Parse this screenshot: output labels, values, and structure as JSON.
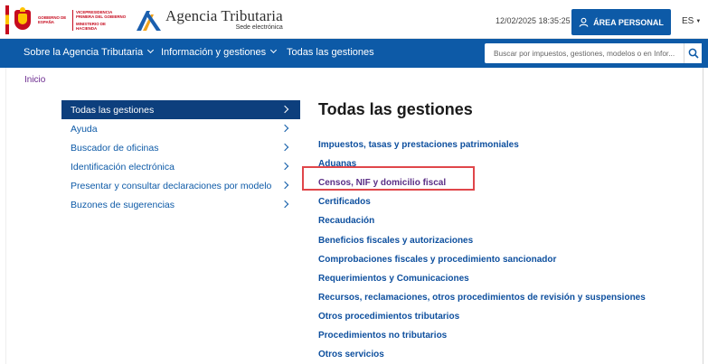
{
  "header": {
    "gov_text_1": "Vicepresidencia Primera del Gobierno",
    "gov_text_2": "Gobierno de España",
    "gov_text_3": "Ministerio de Hacienda",
    "site_title": "Agencia Tributaria",
    "site_subtitle": "Sede electrónica",
    "datetime": "12/02/2025 18:35:25",
    "area_personal_label": "ÁREA PERSONAL",
    "language": "ES",
    "brand_color": "#0d5aa7"
  },
  "nav": {
    "items": [
      {
        "label": "Sobre la Agencia Tributaria"
      },
      {
        "label": "Información y gestiones"
      },
      {
        "label": "Todas las gestiones"
      }
    ],
    "search_placeholder": "Buscar por impuestos, gestiones, modelos o en Infor..."
  },
  "breadcrumb": {
    "label": "Inicio"
  },
  "sidebar": {
    "items": [
      {
        "label": "Todas las gestiones",
        "active": true
      },
      {
        "label": "Ayuda"
      },
      {
        "label": "Buscador de oficinas"
      },
      {
        "label": "Identificación electrónica"
      },
      {
        "label": "Presentar y consultar declaraciones por modelo"
      },
      {
        "label": "Buzones de sugerencias"
      }
    ]
  },
  "main": {
    "title": "Todas las gestiones",
    "gestiones": [
      {
        "label": "Impuestos, tasas y prestaciones patrimoniales"
      },
      {
        "label": "Aduanas"
      },
      {
        "label": "Censos, NIF y domicilio fiscal",
        "highlighted": true
      },
      {
        "label": "Certificados"
      },
      {
        "label": "Recaudación"
      },
      {
        "label": "Beneficios fiscales y autorizaciones"
      },
      {
        "label": "Comprobaciones fiscales y procedimiento sancionador"
      },
      {
        "label": "Requerimientos y Comunicaciones"
      },
      {
        "label": "Recursos, reclamaciones, otros procedimientos de revisión y suspensiones"
      },
      {
        "label": "Otros procedimientos tributarios"
      },
      {
        "label": "Procedimientos no tributarios"
      },
      {
        "label": "Otros servicios"
      }
    ],
    "highlight_color": "#e0464a"
  }
}
